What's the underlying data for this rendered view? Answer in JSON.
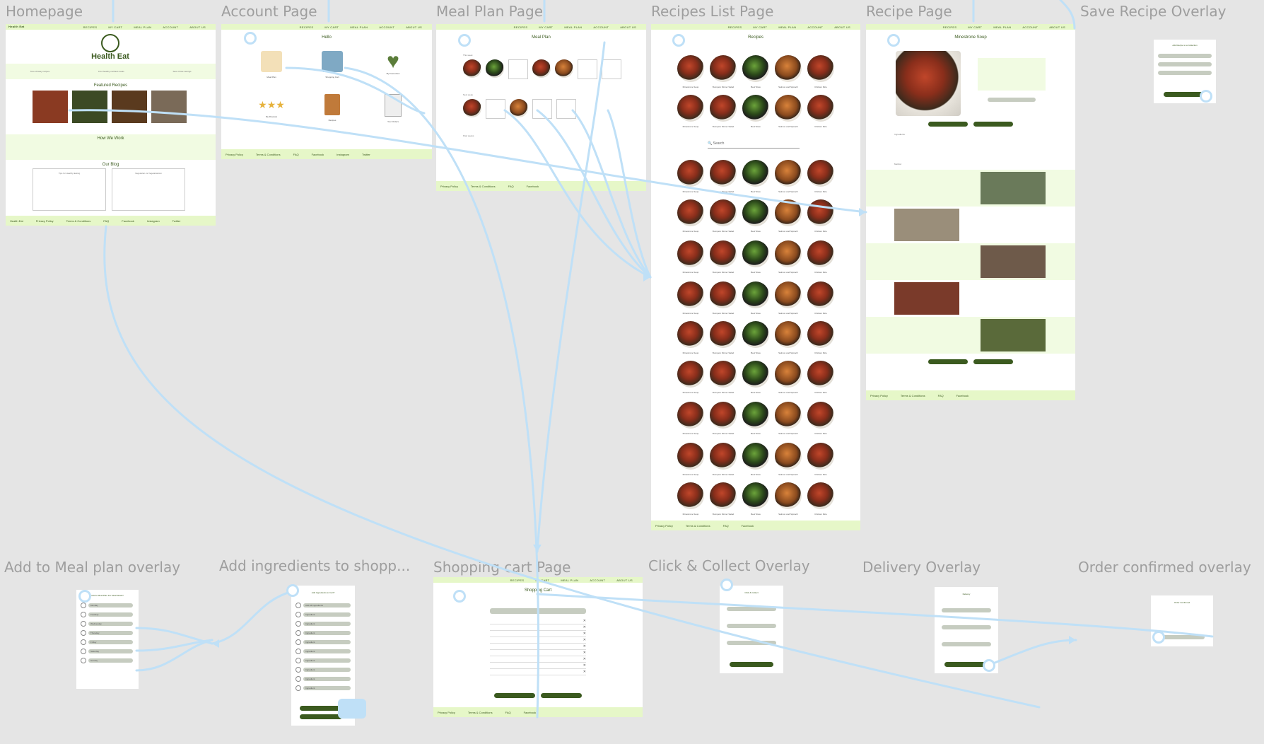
{
  "frames": {
    "homepage": "Homepage",
    "account": "Account Page",
    "meal_plan": "Meal Plan Page",
    "recipes_list": "Recipes List Page",
    "recipe": "Recipe Page",
    "save_recipe": "Save Recipe Overlay",
    "add_meal_plan": "Add to Meal plan overlay",
    "add_ingredients": "Add ingredients to shopp...",
    "shopping_cart": "Shopping cart Page",
    "click_collect": "Click & Collect Overlay",
    "delivery": "Delivery Overlay",
    "order_confirmed": "Order confirmed overlay"
  },
  "nav": [
    "RECIPES",
    "MY CART",
    "MEAL PLAN",
    "ACCOUNT",
    "ABOUT US"
  ],
  "home": {
    "logo": "Health Eat",
    "featured": "Featured Recipes",
    "how": "How We Work",
    "blog": "Our Blog",
    "blog_titles": [
      "Tips for Healthy Eating",
      "Vegetarian vs Vegetarianism"
    ],
    "perks": [
      "Tons of Easy recipes",
      "Find healthy certified meals",
      "Save those savings"
    ]
  },
  "account": {
    "hello": "Hello",
    "tiles": [
      "Meal Plan",
      "Shopping Cart",
      "My Favourites",
      "My Reviews",
      "Recipes",
      "Your Orders"
    ]
  },
  "meal_plan": {
    "title": "Meal Plan",
    "rows": [
      "This week",
      "Next week",
      "Past weeks"
    ]
  },
  "recipes": {
    "title": "Recipes",
    "search": "Search",
    "names": [
      "Minestrone Soup",
      "Bumpers Dinner Salad",
      "Beef Stew",
      "Salmon and Spinach",
      "Chicken Rice"
    ]
  },
  "recipe": {
    "title": "Minestrone Soup",
    "add_collection": "Add to a Collection",
    "add_meal": "Add to Meal Plan",
    "ingredients": "Ingredients",
    "method": "Method"
  },
  "save_overlay": {
    "title": "Add Recipe to a Collection",
    "items": [
      "Ready to Try",
      "Lunch Pick",
      "New Collection"
    ],
    "button": "Save"
  },
  "meal_overlay": {
    "title": "Add to Meal Plan For Meal Week?",
    "days": [
      "Monday",
      "Tuesday",
      "Wednesday",
      "Thursday",
      "Friday",
      "Saturday",
      "Sunday"
    ]
  },
  "ingr_overlay": {
    "title": "Add Ingredients to Cart?",
    "all": "Add All Ingredients",
    "item": "Ingredient",
    "btn1": "Add and Close",
    "btn2": "Add Single Item"
  },
  "cart": {
    "title": "Shopping Cart",
    "select": "Select Store",
    "total": "Total: $---",
    "btn1": "Click & Collect",
    "btn2": "Delivery"
  },
  "cc": {
    "title": "Click & Collect",
    "store": "Select Store",
    "time": "Select Time Slot",
    "pay": "Select Payment Method",
    "total": "Total: $---",
    "btn": "Confirm & Pay"
  },
  "delivery": {
    "title": "Delivery",
    "store": "Select Store",
    "address": "Select Address",
    "pay": "Select Payment Method",
    "total": "Total: $---",
    "btn": "Confirm & Pay"
  },
  "confirmed": {
    "title": "Order Confirmed",
    "btn": "Return To Homepage"
  },
  "footer": [
    "Privacy Policy",
    "Terms & Conditions",
    "FAQ",
    "Facebook",
    "Instagram",
    "Twitter"
  ],
  "colors": {
    "brand": "#3b5a1f",
    "band": "#e6f7c8",
    "connector": "#bfe0f7"
  }
}
